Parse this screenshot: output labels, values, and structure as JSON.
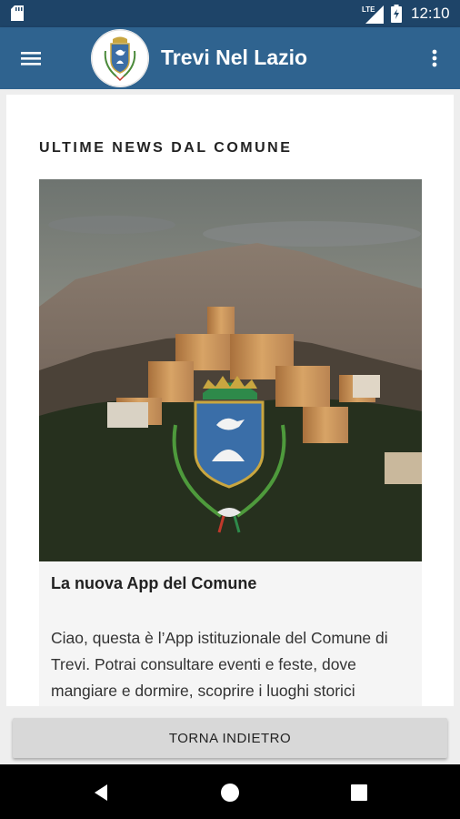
{
  "status_bar": {
    "time": "12:10",
    "network_label": "LTE",
    "icons": [
      "sd-card-icon",
      "lte-signal-icon",
      "battery-charging-icon"
    ]
  },
  "app_bar": {
    "title": "Trevi Nel Lazio",
    "icons": [
      "menu-icon",
      "coat-of-arms-logo",
      "more-vert-icon"
    ],
    "color": "#2f638f"
  },
  "main": {
    "section_title": "ULTIME NEWS DAL COMUNE",
    "news": {
      "image": "village-with-coat-of-arms-photo",
      "title": "La nuova App del Comune",
      "text": "Ciao, questa è l’App istituzionale del Comune di Trevi. Potrai consultare eventi e feste, dove mangiare e dormire, scoprire i luoghi storici"
    }
  },
  "bottom": {
    "back_label": "TORNA INDIETRO"
  },
  "nav_bar": {
    "icons": [
      "back-triangle-icon",
      "home-circle-icon",
      "recent-apps-square-icon"
    ]
  }
}
